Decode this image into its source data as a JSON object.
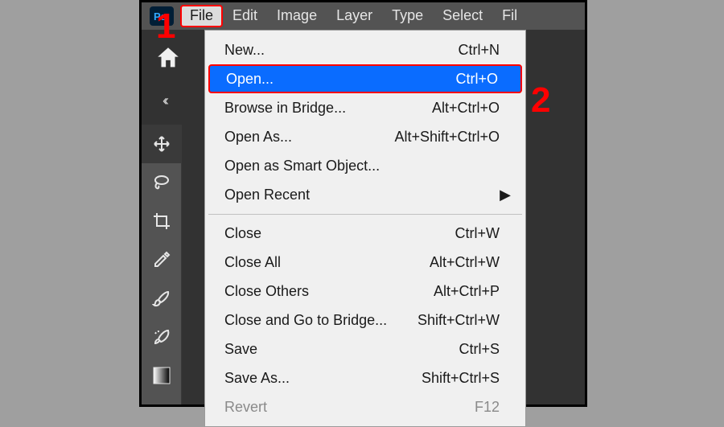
{
  "menubar": {
    "items": [
      "File",
      "Edit",
      "Image",
      "Layer",
      "Type",
      "Select",
      "Fil"
    ]
  },
  "annotations": {
    "one": "1",
    "two": "2"
  },
  "leftstrip": {
    "collapse_glyph": "‹‹"
  },
  "dropdown": {
    "group1": [
      {
        "label": "New...",
        "shortcut": "Ctrl+N"
      },
      {
        "label": "Open...",
        "shortcut": "Ctrl+O",
        "highlight": true
      },
      {
        "label": "Browse in Bridge...",
        "shortcut": "Alt+Ctrl+O"
      },
      {
        "label": "Open As...",
        "shortcut": "Alt+Shift+Ctrl+O"
      },
      {
        "label": "Open as Smart Object...",
        "shortcut": ""
      },
      {
        "label": "Open Recent",
        "shortcut": "",
        "submenu": true
      }
    ],
    "group2": [
      {
        "label": "Close",
        "shortcut": "Ctrl+W"
      },
      {
        "label": "Close All",
        "shortcut": "Alt+Ctrl+W"
      },
      {
        "label": "Close Others",
        "shortcut": "Alt+Ctrl+P"
      },
      {
        "label": "Close and Go to Bridge...",
        "shortcut": "Shift+Ctrl+W"
      },
      {
        "label": "Save",
        "shortcut": "Ctrl+S"
      },
      {
        "label": "Save As...",
        "shortcut": "Shift+Ctrl+S"
      },
      {
        "label": "Revert",
        "shortcut": "F12",
        "disabled": true
      }
    ]
  }
}
